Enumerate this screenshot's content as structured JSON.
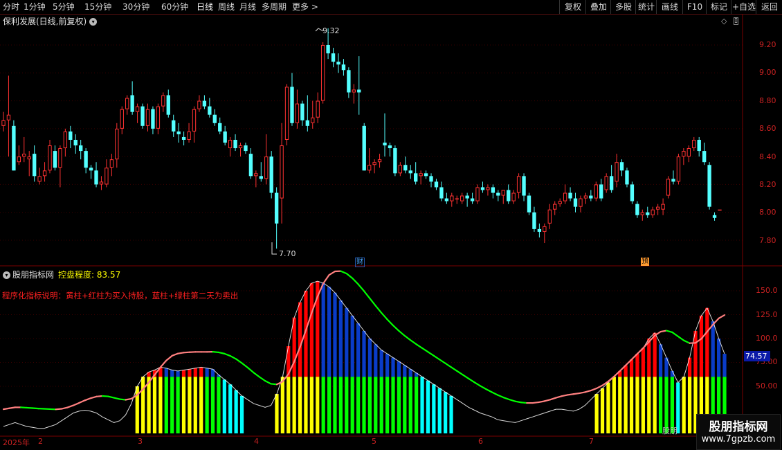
{
  "toolbar": {
    "left_items": [
      "分时",
      "1分钟",
      "5分钟",
      "15分钟",
      "30分钟",
      "60分钟",
      "日线",
      "周线",
      "月线",
      "多周期",
      "更多 >"
    ],
    "active": "日线",
    "right_items": [
      "复权",
      "叠加",
      "多股",
      "统计",
      "画线",
      "F10",
      "标记",
      "+自选",
      "返回"
    ]
  },
  "price_panel": {
    "title": "保利发展(日线,前复权)",
    "high_label": "9.32",
    "low_label": "7.70",
    "markers": [
      "财",
      "预"
    ],
    "y_ticks": [
      "9.20",
      "9.00",
      "8.80",
      "8.60",
      "8.40",
      "8.20",
      "8.00",
      "7.80"
    ]
  },
  "indicator_panel": {
    "title": "股朋指标网",
    "name": "控盘程度: 83.57",
    "description": "程序化指标说明：黄柱+红柱为买入持股，蓝柱+绿柱第二天为卖出",
    "y_ticks": [
      "150.0",
      "125.0",
      "100.0",
      "75.00",
      "50.00"
    ],
    "current_value": "74.57",
    "bottom_label": "股朋"
  },
  "date_axis": [
    "2025年",
    "2",
    "3",
    "4",
    "5",
    "6",
    "7"
  ],
  "watermark": {
    "line1": "股朋指标网",
    "line2": "www.7gpzb.com"
  },
  "colors": {
    "up": "#ff3232",
    "down": "#54ffff",
    "yellow": "#ffff00",
    "red": "#ff0000",
    "blue": "#0a3cc8",
    "green": "#00ff00",
    "cyan": "#00ffff",
    "pink": "#ff8080",
    "grid": "#3c0000"
  },
  "chart_data": {
    "type": "candlestick",
    "price_range": [
      7.62,
      9.42
    ],
    "indicator_range": [
      0,
      170
    ],
    "candles_ohlc": [
      [
        8.62,
        8.72,
        8.58,
        8.66
      ],
      [
        8.66,
        8.98,
        8.4,
        8.7
      ],
      [
        8.62,
        8.66,
        8.3,
        8.3
      ],
      [
        8.36,
        8.48,
        8.34,
        8.4
      ],
      [
        8.4,
        8.54,
        8.36,
        8.42
      ],
      [
        8.38,
        8.44,
        8.26,
        8.4
      ],
      [
        8.42,
        8.48,
        8.22,
        8.26
      ],
      [
        8.22,
        8.32,
        8.2,
        8.26
      ],
      [
        8.26,
        8.36,
        8.22,
        8.3
      ],
      [
        8.3,
        8.52,
        8.28,
        8.48
      ],
      [
        8.44,
        8.48,
        8.3,
        8.32
      ],
      [
        8.32,
        8.48,
        8.18,
        8.46
      ],
      [
        8.46,
        8.6,
        8.4,
        8.58
      ],
      [
        8.58,
        8.62,
        8.46,
        8.52
      ],
      [
        8.52,
        8.56,
        8.42,
        8.48
      ],
      [
        8.48,
        8.52,
        8.38,
        8.44
      ],
      [
        8.44,
        8.46,
        8.28,
        8.32
      ],
      [
        8.32,
        8.34,
        8.24,
        8.3
      ],
      [
        8.3,
        8.36,
        8.18,
        8.2
      ],
      [
        8.2,
        8.26,
        8.16,
        8.22
      ],
      [
        8.2,
        8.38,
        8.18,
        8.32
      ],
      [
        8.32,
        8.42,
        8.26,
        8.38
      ],
      [
        8.38,
        8.64,
        8.32,
        8.6
      ],
      [
        8.6,
        8.76,
        8.56,
        8.74
      ],
      [
        8.74,
        8.84,
        8.7,
        8.82
      ],
      [
        8.84,
        8.94,
        8.7,
        8.72
      ],
      [
        8.72,
        8.78,
        8.64,
        8.76
      ],
      [
        8.76,
        8.78,
        8.6,
        8.62
      ],
      [
        8.62,
        8.78,
        8.58,
        8.74
      ],
      [
        8.74,
        8.76,
        8.56,
        8.6
      ],
      [
        8.6,
        8.78,
        8.56,
        8.76
      ],
      [
        8.76,
        8.86,
        8.72,
        8.84
      ],
      [
        8.84,
        8.88,
        8.68,
        8.7
      ],
      [
        8.66,
        8.7,
        8.54,
        8.58
      ],
      [
        8.58,
        8.64,
        8.5,
        8.56
      ],
      [
        8.54,
        8.58,
        8.48,
        8.52
      ],
      [
        8.52,
        8.64,
        8.5,
        8.58
      ],
      [
        8.58,
        8.76,
        8.5,
        8.74
      ],
      [
        8.74,
        8.84,
        8.72,
        8.8
      ],
      [
        8.8,
        8.84,
        8.74,
        8.76
      ],
      [
        8.76,
        8.82,
        8.68,
        8.7
      ],
      [
        8.7,
        8.74,
        8.62,
        8.64
      ],
      [
        8.64,
        8.68,
        8.56,
        8.58
      ],
      [
        8.58,
        8.62,
        8.48,
        8.5
      ],
      [
        8.46,
        8.54,
        8.4,
        8.52
      ],
      [
        8.52,
        8.56,
        8.44,
        8.46
      ],
      [
        8.46,
        8.5,
        8.4,
        8.48
      ],
      [
        8.48,
        8.5,
        8.42,
        8.44
      ],
      [
        8.42,
        8.46,
        8.24,
        8.26
      ],
      [
        8.26,
        8.3,
        8.18,
        8.28
      ],
      [
        8.26,
        8.36,
        8.22,
        8.24
      ],
      [
        8.24,
        8.56,
        8.2,
        8.4
      ],
      [
        8.4,
        8.44,
        8.1,
        8.14
      ],
      [
        8.14,
        8.18,
        7.74,
        7.92
      ],
      [
        8.1,
        8.64,
        7.92,
        8.48
      ],
      [
        8.52,
        8.92,
        8.48,
        8.9
      ],
      [
        8.9,
        9.0,
        8.62,
        8.64
      ],
      [
        8.64,
        8.88,
        8.6,
        8.78
      ],
      [
        8.78,
        8.8,
        8.62,
        8.66
      ],
      [
        8.66,
        8.84,
        8.58,
        8.62
      ],
      [
        8.64,
        8.8,
        8.6,
        8.68
      ],
      [
        8.68,
        8.86,
        8.64,
        8.8
      ],
      [
        8.8,
        9.22,
        8.78,
        9.2
      ],
      [
        9.2,
        9.32,
        9.1,
        9.14
      ],
      [
        9.14,
        9.18,
        9.04,
        9.08
      ],
      [
        9.08,
        9.14,
        9.0,
        9.06
      ],
      [
        9.06,
        9.1,
        8.98,
        9.02
      ],
      [
        9.02,
        9.04,
        8.82,
        8.86
      ],
      [
        8.86,
        8.92,
        8.78,
        8.88
      ],
      [
        8.88,
        9.12,
        8.7,
        8.86
      ],
      [
        8.62,
        8.64,
        8.3,
        8.3
      ],
      [
        8.3,
        8.46,
        8.28,
        8.34
      ],
      [
        8.34,
        8.38,
        8.28,
        8.36
      ],
      [
        8.36,
        8.42,
        8.32,
        8.38
      ],
      [
        8.5,
        8.71,
        8.4,
        8.48
      ],
      [
        8.48,
        8.5,
        8.4,
        8.46
      ],
      [
        8.46,
        8.48,
        8.26,
        8.28
      ],
      [
        8.28,
        8.36,
        8.26,
        8.34
      ],
      [
        8.34,
        8.4,
        8.28,
        8.3
      ],
      [
        8.3,
        8.34,
        8.24,
        8.28
      ],
      [
        8.28,
        8.36,
        8.2,
        8.22
      ],
      [
        8.26,
        8.3,
        8.2,
        8.28
      ],
      [
        8.28,
        8.3,
        8.24,
        8.26
      ],
      [
        8.26,
        8.28,
        8.18,
        8.22
      ],
      [
        8.22,
        8.24,
        8.16,
        8.18
      ],
      [
        8.18,
        8.22,
        8.08,
        8.1
      ],
      [
        8.1,
        8.14,
        8.06,
        8.08
      ],
      [
        8.08,
        8.14,
        8.04,
        8.12
      ],
      [
        8.1,
        8.12,
        8.06,
        8.1
      ],
      [
        8.08,
        8.14,
        8.06,
        8.12
      ],
      [
        8.12,
        8.14,
        8.04,
        8.1
      ],
      [
        8.1,
        8.14,
        8.06,
        8.08
      ],
      [
        8.08,
        8.2,
        8.06,
        8.18
      ],
      [
        8.18,
        8.22,
        8.14,
        8.16
      ],
      [
        8.16,
        8.2,
        8.12,
        8.18
      ],
      [
        8.18,
        8.2,
        8.1,
        8.14
      ],
      [
        8.14,
        8.16,
        8.08,
        8.12
      ],
      [
        8.12,
        8.16,
        8.06,
        8.16
      ],
      [
        8.16,
        8.2,
        8.06,
        8.08
      ],
      [
        8.08,
        8.16,
        8.06,
        8.14
      ],
      [
        8.14,
        8.28,
        8.1,
        8.26
      ],
      [
        8.26,
        8.28,
        8.08,
        8.12
      ],
      [
        8.12,
        8.14,
        7.98,
        8.0
      ],
      [
        8.0,
        8.04,
        7.86,
        7.88
      ],
      [
        7.88,
        7.92,
        7.82,
        7.86
      ],
      [
        7.86,
        7.92,
        7.78,
        7.9
      ],
      [
        7.92,
        8.06,
        7.88,
        8.02
      ],
      [
        8.02,
        8.08,
        7.98,
        8.06
      ],
      [
        8.06,
        8.1,
        8.04,
        8.08
      ],
      [
        8.08,
        8.2,
        8.06,
        8.14
      ],
      [
        8.14,
        8.18,
        8.08,
        8.1
      ],
      [
        8.1,
        8.14,
        8.0,
        8.04
      ],
      [
        8.04,
        8.12,
        8.0,
        8.1
      ],
      [
        8.1,
        8.14,
        8.06,
        8.12
      ],
      [
        8.12,
        8.16,
        8.08,
        8.1
      ],
      [
        8.1,
        8.22,
        8.08,
        8.2
      ],
      [
        8.2,
        8.24,
        8.08,
        8.1
      ],
      [
        8.16,
        8.28,
        8.14,
        8.26
      ],
      [
        8.26,
        8.34,
        8.14,
        8.16
      ],
      [
        8.22,
        8.42,
        8.18,
        8.36
      ],
      [
        8.36,
        8.38,
        8.26,
        8.3
      ],
      [
        8.3,
        8.32,
        8.18,
        8.2
      ],
      [
        8.2,
        8.22,
        8.06,
        8.08
      ],
      [
        8.06,
        8.08,
        7.96,
        7.98
      ],
      [
        7.98,
        8.02,
        7.94,
        8.0
      ],
      [
        8.0,
        8.04,
        7.96,
        7.98
      ],
      [
        7.98,
        8.04,
        7.96,
        8.02
      ],
      [
        8.02,
        8.06,
        7.98,
        8.04
      ],
      [
        8.02,
        8.1,
        7.98,
        8.06
      ],
      [
        8.12,
        8.26,
        8.1,
        8.24
      ],
      [
        8.24,
        8.3,
        8.2,
        8.22
      ],
      [
        8.22,
        8.42,
        8.2,
        8.4
      ],
      [
        8.4,
        8.46,
        8.34,
        8.44
      ],
      [
        8.4,
        8.48,
        8.36,
        8.46
      ],
      [
        8.46,
        8.54,
        8.44,
        8.52
      ],
      [
        8.52,
        8.54,
        8.4,
        8.44
      ],
      [
        8.44,
        8.5,
        8.34,
        8.36
      ],
      [
        8.34,
        8.36,
        8.02,
        8.04
      ],
      [
        7.98,
        8.0,
        7.94,
        7.96
      ],
      [
        8.02,
        8.02,
        8.02,
        8.02
      ]
    ],
    "control_degree": [
      8,
      10,
      12,
      10,
      8,
      7,
      6,
      6,
      8,
      10,
      14,
      18,
      22,
      24,
      25,
      24,
      22,
      18,
      15,
      12,
      14,
      20,
      32,
      50,
      60,
      65,
      67,
      70,
      69,
      67,
      66,
      67,
      68,
      69,
      70,
      69,
      68,
      62,
      57,
      52,
      46,
      40,
      36,
      32,
      30,
      28,
      30,
      42,
      60,
      92,
      122,
      138,
      150,
      158,
      160,
      158,
      154,
      148,
      140,
      132,
      124,
      116,
      108,
      100,
      94,
      88,
      84,
      80,
      76,
      72,
      68,
      64,
      60,
      56,
      52,
      48,
      44,
      40,
      36,
      32,
      28,
      25,
      22,
      20,
      18,
      15,
      14,
      13,
      12,
      14,
      16,
      18,
      20,
      22,
      24,
      26,
      26,
      25,
      24,
      26,
      30,
      36,
      42,
      48,
      54,
      60,
      66,
      72,
      78,
      84,
      90,
      100,
      106,
      94,
      80,
      66,
      54,
      60,
      80,
      108,
      124,
      132,
      118,
      100,
      84
    ]
  }
}
